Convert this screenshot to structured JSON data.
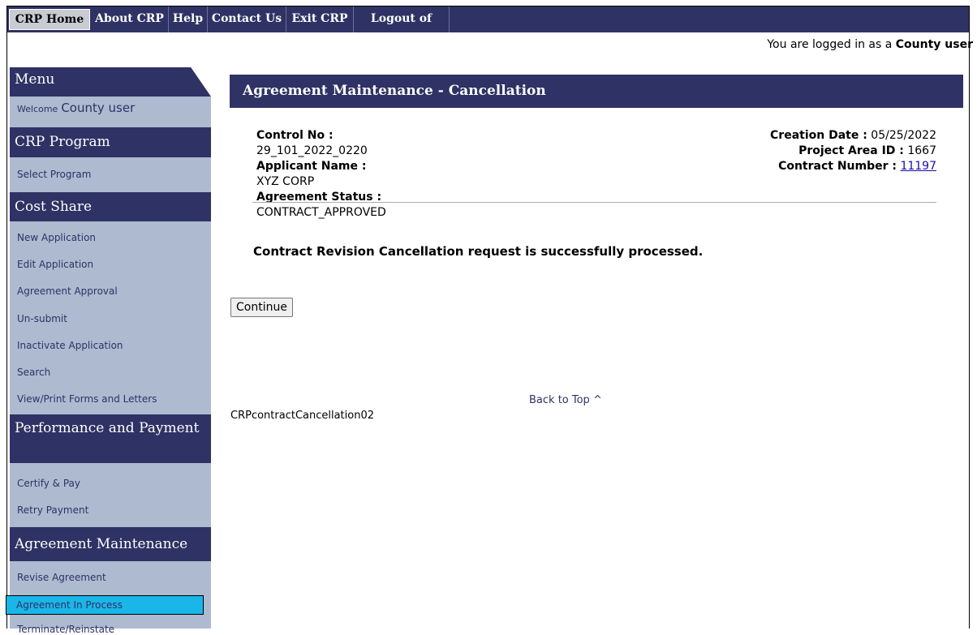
{
  "topnav": {
    "tabs": [
      "CRP Home",
      "About CRP",
      "Help",
      "Contact Us",
      "Exit CRP",
      "Logout of eAuth"
    ]
  },
  "header": {
    "logged_in_prefix": "You are logged in as a",
    "logged_in_role": "County user"
  },
  "sidebar": {
    "menu_title": "Menu",
    "welcome_label": "Welcome",
    "welcome_name": "County user",
    "sections": [
      {
        "title": "CRP Program",
        "items": [
          "Select Program"
        ]
      },
      {
        "title": "Cost Share",
        "items": [
          "New Application",
          "Edit Application",
          "Agreement Approval",
          "Un-submit",
          "Inactivate Application",
          "Search",
          "View/Print Forms and Letters"
        ]
      },
      {
        "title": "Performance and Payment",
        "items": [
          "Certify & Pay",
          "Retry Payment"
        ]
      },
      {
        "title": "Agreement Maintenance",
        "items": [
          "Revise Agreement",
          "Agreement In Process",
          "Terminate/Reinstate"
        ]
      }
    ],
    "selected_item": "Agreement In Process"
  },
  "main": {
    "title": "Agreement Maintenance - Cancellation",
    "control_no_label": "Control No :",
    "control_no": "29_101_2022_0220",
    "applicant_label": "Applicant Name :",
    "applicant": "XYZ CORP",
    "status_label": "Agreement Status :",
    "status": "CONTRACT_APPROVED",
    "creation_label": "Creation Date :",
    "creation_date": "05/25/2022",
    "project_label": "Project Area ID :",
    "project_id": "1667",
    "contract_label": "Contract Number :",
    "contract_number": "11197",
    "message": "Contract Revision Cancellation request is successfully processed.",
    "continue_label": "Continue",
    "back_to_top": "Back to Top ^",
    "page_id": "CRPcontractCancellation02"
  }
}
